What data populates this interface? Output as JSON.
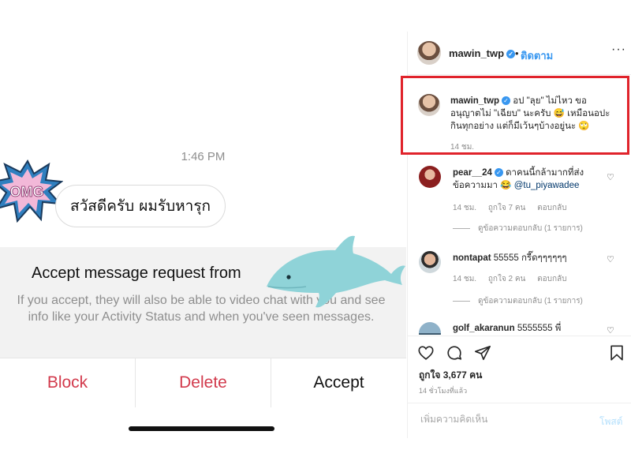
{
  "dm": {
    "timestamp": "1:46 PM",
    "sticker_text": "OMG",
    "message": "สวัสดีครับ ผมรับหารุก",
    "request_title": "Accept message request from",
    "request_description": "If you accept, they will also be able to video chat with you and see info like your Activity Status and when you've seen messages.",
    "buttons": {
      "block": "Block",
      "delete": "Delete",
      "accept": "Accept"
    }
  },
  "post": {
    "header": {
      "username": "mawin_twp",
      "dot": "•",
      "follow": "ติดตาม",
      "more": "···"
    },
    "caption": {
      "username": "mawin_twp",
      "text": "อป \"ลุย\" ไม่ไหว ขออนุญาตไม่ \"เฉียบ\" นะครับ 😅 เหมือนอปะกินทุกอย่าง แต่ก็มีเว้นๆบ้างอยู่นะ 🙄",
      "time": "14 ชม."
    },
    "comments": [
      {
        "username": "pear__24",
        "text": "ดาคนนี้กล้ามากที่ส่งข้อความมา 😂",
        "mention": "@tu_piyawadee",
        "time": "14 ชม.",
        "likes": "ถูกใจ 7 คน",
        "reply": "ตอบกลับ",
        "view_replies": "ดูข้อความตอบกลับ (1 รายการ)"
      },
      {
        "username": "nontapat",
        "text": "55555 กรี๊ดๆๆๆๆๆๆ",
        "time": "14 ชม.",
        "likes": "ถูกใจ 2 คน",
        "reply": "ตอบกลับ",
        "view_replies": "ดูข้อความตอบกลับ (1 รายการ)"
      },
      {
        "username": "golf_akaranun",
        "text": "5555555 พี่"
      }
    ],
    "likes": "ถูกใจ 3,677 คน",
    "age": "14 ชั่วโมงที่แล้ว",
    "comment_placeholder": "เพิ่มความคิดเห็น",
    "post_button": "โพสต์"
  },
  "colors": {
    "accent_red": "#d23a4c",
    "highlight_box": "#e0232b",
    "link_blue": "#3897f0",
    "dolphin": "#8fd3d8"
  },
  "icons": [
    "omg-sticker-icon",
    "dolphin-icon",
    "verified-icon",
    "more-icon",
    "heart-icon",
    "comment-icon",
    "share-icon",
    "bookmark-icon"
  ]
}
